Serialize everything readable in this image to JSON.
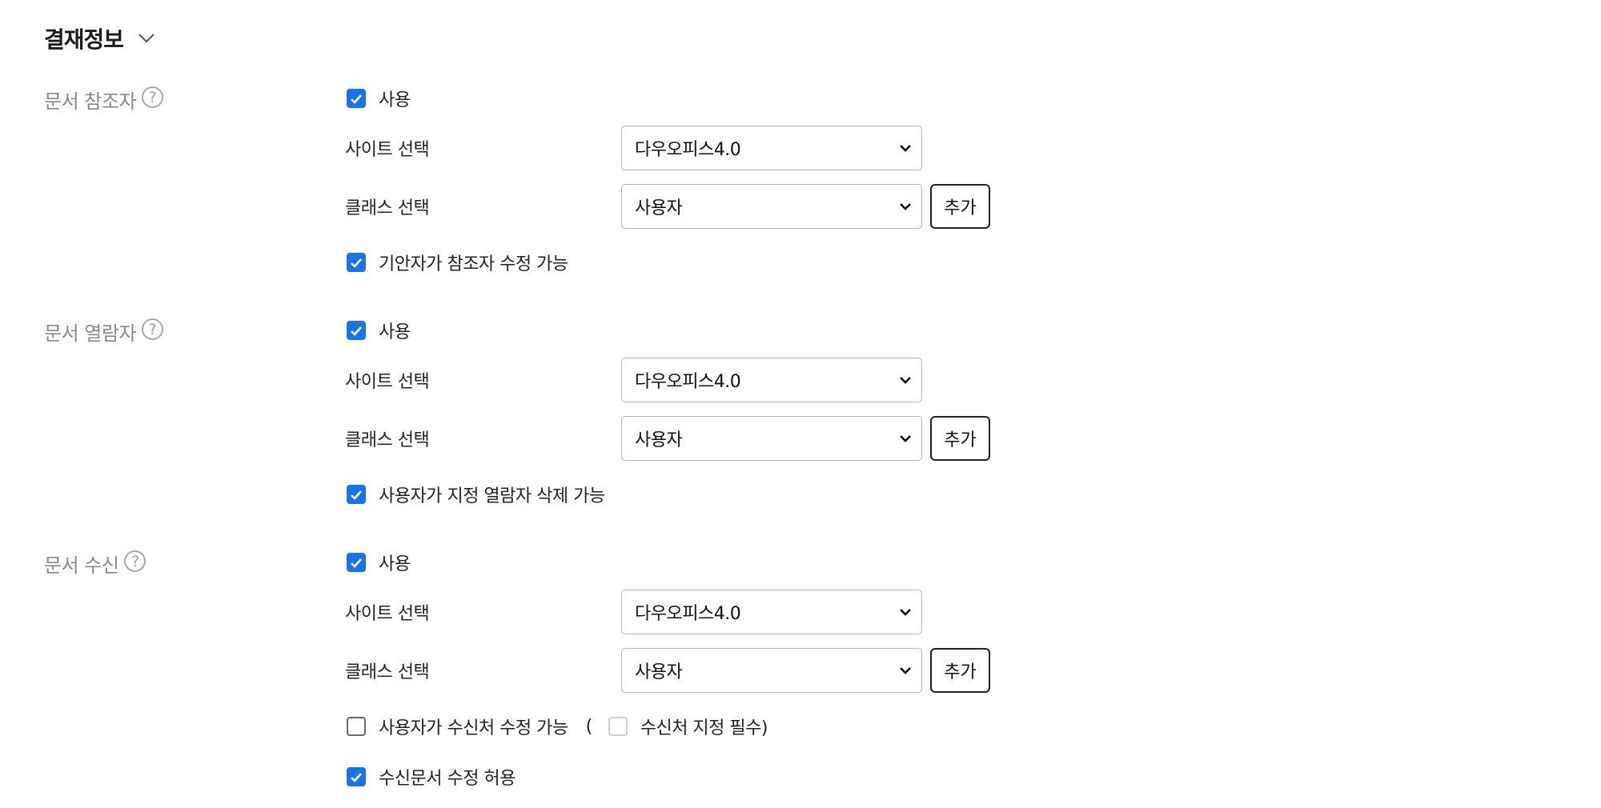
{
  "header": {
    "title": "결재정보"
  },
  "sections": [
    {
      "label": "문서 참조자",
      "use_label": "사용",
      "site_label": "사이트 선택",
      "site_value": "다우오피스4.0",
      "class_label": "클래스 선택",
      "class_value": "사용자",
      "add_label": "추가",
      "option_label": "기안자가 참조자 수정 가능"
    },
    {
      "label": "문서 열람자",
      "use_label": "사용",
      "site_label": "사이트 선택",
      "site_value": "다우오피스4.0",
      "class_label": "클래스 선택",
      "class_value": "사용자",
      "add_label": "추가",
      "option_label": "사용자가 지정 열람자 삭제 가능"
    },
    {
      "label": "문서 수신",
      "use_label": "사용",
      "site_label": "사이트 선택",
      "site_value": "다우오피스4.0",
      "class_label": "클래스 선택",
      "class_value": "사용자",
      "add_label": "추가",
      "option_label": "사용자가 수신처 수정 가능",
      "paren_open": "(",
      "sub_option_label": "수신처 지정 필수)",
      "option2_label": "수신문서 수정 허용"
    }
  ],
  "help_glyph": "?",
  "colors": {
    "checkbox_checked": "#1a73e8",
    "section_label": "#8a8a8a"
  }
}
